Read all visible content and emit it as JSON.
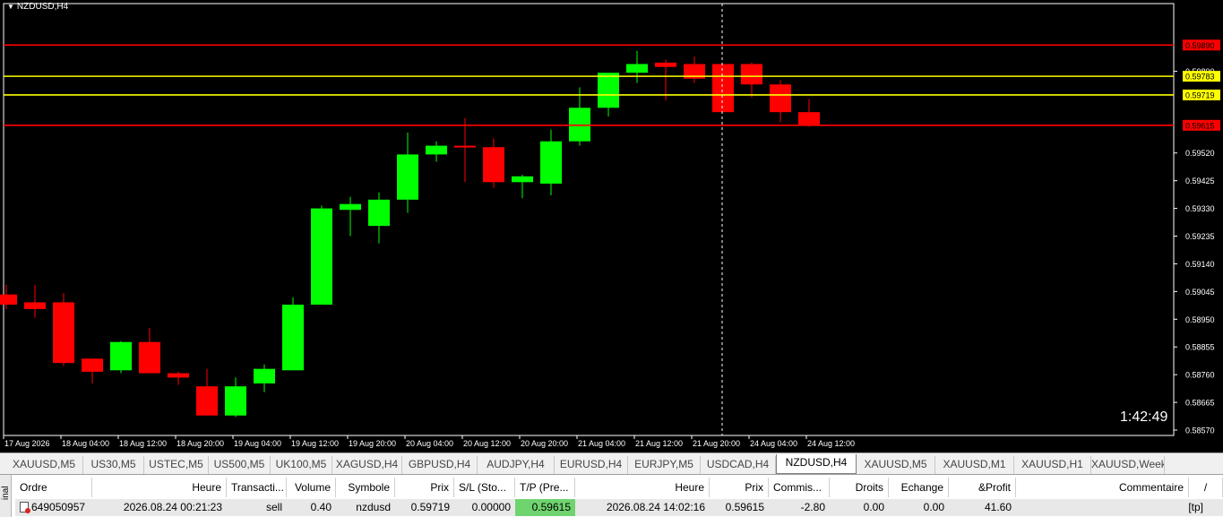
{
  "chart": {
    "symbol_label": "NZDUSD,H4",
    "timer": "1:42:49",
    "price_min": 0.5857,
    "price_max": 0.5998,
    "price_labels": [
      "0.59800",
      "0.59520",
      "0.59425",
      "0.59330",
      "0.59235",
      "0.59140",
      "0.59045",
      "0.58950",
      "0.58855",
      "0.58760",
      "0.58665",
      "0.58570"
    ],
    "time_labels": [
      "17 Aug 2026",
      "18 Aug 04:00",
      "18 Aug 12:00",
      "18 Aug 20:00",
      "19 Aug 04:00",
      "19 Aug 12:00",
      "19 Aug 20:00",
      "20 Aug 04:00",
      "20 Aug 12:00",
      "20 Aug 20:00",
      "21 Aug 04:00",
      "21 Aug 12:00",
      "21 Aug 20:00",
      "24 Aug 04:00",
      "24 Aug 12:00"
    ],
    "levels": [
      {
        "price": 0.5989,
        "label": "0.59890",
        "color": "#ff0000"
      },
      {
        "price": 0.59783,
        "label": "0.59783",
        "color": "#ffff00"
      },
      {
        "price": 0.59719,
        "label": "0.59719",
        "color": "#ffff00"
      },
      {
        "price": 0.59615,
        "label": "0.59615",
        "color": "#ff0000"
      }
    ],
    "colors": {
      "bull": "#00ff00",
      "bear": "#ff0000",
      "background": "#000000",
      "axis_text": "#ffffff"
    }
  },
  "tabs": [
    "XAUUSD,M5",
    "US30,M5",
    "USTEC,M5",
    "US500,M5",
    "UK100,M5",
    "XAGUSD,H4",
    "GBPUSD,H4",
    "AUDJPY,H4",
    "EURUSD,H4",
    "EURJPY,M5",
    "USDCAD,H4",
    "NZDUSD,H4",
    "XAUUSD,M5",
    "XAUUSD,M1",
    "XAUUSD,H1",
    "XAUUSD,Week"
  ],
  "active_tab": "NZDUSD,H4",
  "terminal": {
    "side_label": "inal",
    "columns": [
      "Ordre",
      "Heure",
      "Transacti...",
      "Volume",
      "Symbole",
      "Prix",
      "S/L (Sto...",
      "T/P (Pre...",
      "Heure",
      "Prix",
      "Commis...",
      "Droits",
      "Echange",
      "&Profit",
      "Commentaire"
    ],
    "sort_indicator": "/",
    "row": {
      "ordre": "649050957",
      "heure": "2026.08.24 00:21:23",
      "transaction": "sell",
      "volume": "0.40",
      "symbole": "nzdusd",
      "prix": "0.59719",
      "sl": "0.00000",
      "tp": "0.59615",
      "heure2": "2026.08.24 14:02:16",
      "prix2": "0.59615",
      "commission": "-2.80",
      "droits": "0.00",
      "echange": "0.00",
      "profit": "41.60",
      "commentaire": "[tp]"
    }
  }
}
